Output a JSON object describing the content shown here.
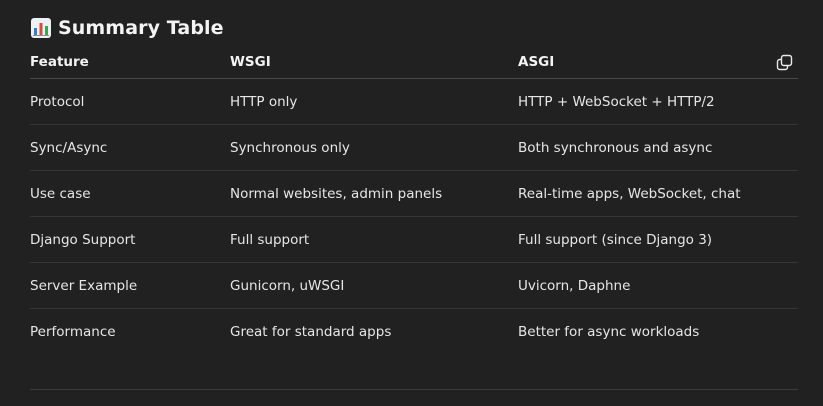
{
  "section": {
    "title": "Summary Table",
    "icon": "bar-chart-icon"
  },
  "table": {
    "headers": [
      "Feature",
      "WSGI",
      "ASGI"
    ],
    "rows": [
      [
        "Protocol",
        "HTTP only",
        "HTTP + WebSocket + HTTP/2"
      ],
      [
        "Sync/Async",
        "Synchronous only",
        "Both synchronous and async"
      ],
      [
        "Use case",
        "Normal websites, admin panels",
        "Real-time apps, WebSocket, chat"
      ],
      [
        "Django Support",
        "Full support",
        "Full support (since Django 3)"
      ],
      [
        "Server Example",
        "Gunicorn, uWSGI",
        "Uvicorn, Daphne"
      ],
      [
        "Performance",
        "Great for standard apps",
        "Better for async workloads"
      ]
    ],
    "copy_icon": "copy-icon"
  },
  "colors": {
    "background": "#212121",
    "text": "#e6e6e6",
    "divider": "#363636"
  }
}
